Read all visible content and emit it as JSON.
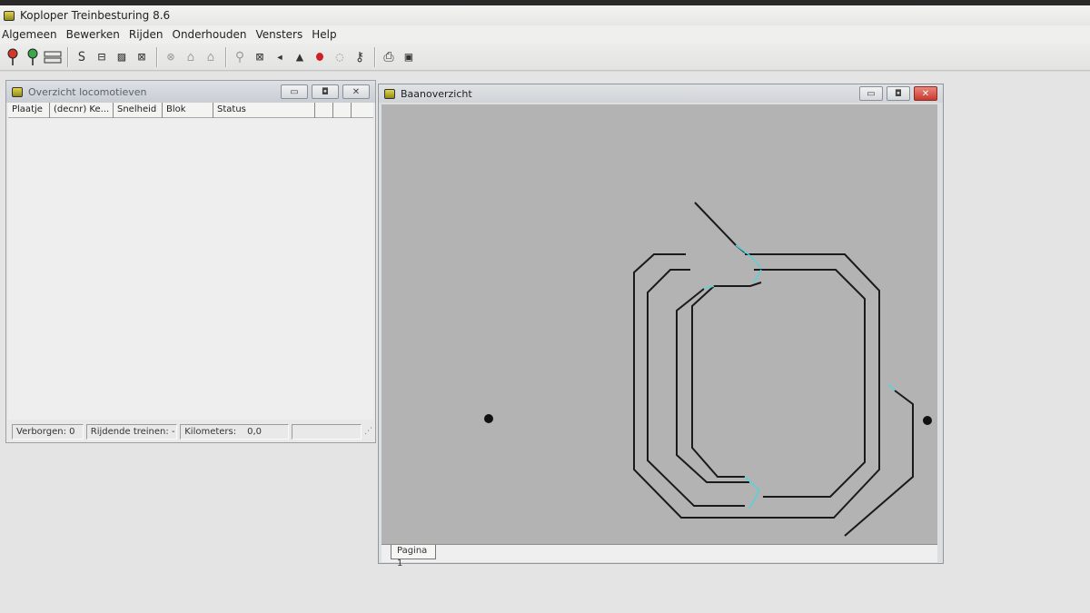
{
  "app": {
    "title": "Koploper Treinbesturing 8.6"
  },
  "menu": [
    "Algemeen",
    "Bewerken",
    "Rijden",
    "Onderhouden",
    "Vensters",
    "Help"
  ],
  "toolbar": {
    "buttons": [
      {
        "name": "red-signal-icon"
      },
      {
        "name": "green-signal-icon"
      },
      {
        "name": "block-icon"
      },
      {
        "glyph": "S",
        "name": "s-icon"
      },
      {
        "glyph": "⊟",
        "name": "track-icon"
      },
      {
        "glyph": "▨",
        "name": "switch-icon"
      },
      {
        "glyph": "⊠",
        "name": "crossing-icon"
      },
      {
        "glyph": "⊗",
        "name": "detector-icon"
      },
      {
        "glyph": "⌂",
        "name": "house-icon"
      },
      {
        "glyph": "⌂",
        "name": "bell-icon"
      },
      {
        "glyph": "⚲",
        "name": "settings-icon"
      },
      {
        "glyph": "⊠",
        "name": "cancel-icon"
      },
      {
        "glyph": "◂",
        "name": "speaker-icon"
      },
      {
        "glyph": "▲",
        "name": "loco-icon"
      },
      {
        "name": "stop-icon"
      },
      {
        "glyph": "◌",
        "name": "clock-icon"
      },
      {
        "glyph": "⚷",
        "name": "key-icon"
      },
      {
        "glyph": "⎙",
        "name": "print-icon"
      },
      {
        "glyph": "▣",
        "name": "excel-icon"
      }
    ]
  },
  "loco_window": {
    "title": "Overzicht locomotieven",
    "columns": [
      "Plaatje",
      "(decnr) Ke...",
      "Snelheid",
      "Blok",
      "Status",
      "",
      ""
    ],
    "status": {
      "hidden": "Verborgen: 0",
      "driving": "Rijdende treinen: -",
      "km_label": "Kilometers:",
      "km_value": "0,0"
    }
  },
  "track_window": {
    "title": "Baanoverzicht",
    "tab": "Pagina 1"
  },
  "colors": {
    "track": "#1a1a1a",
    "switch_accent": "#58d2d6",
    "canvas": "#b3b3b3"
  }
}
